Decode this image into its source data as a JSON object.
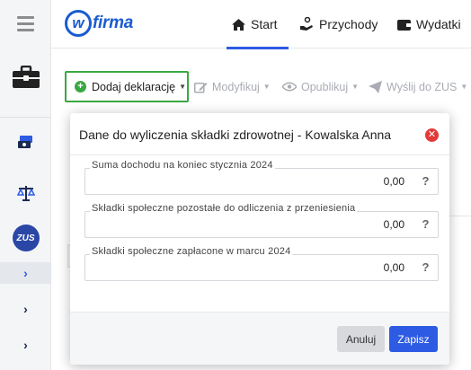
{
  "header": {
    "logo_text": "firma",
    "logo_letter": "w",
    "nav": [
      {
        "label": "Start",
        "icon": "home-icon"
      },
      {
        "label": "Przychody",
        "icon": "hand-coins-icon"
      },
      {
        "label": "Wydatki",
        "icon": "wallet-icon"
      }
    ]
  },
  "sidebar": {
    "items": [
      {
        "icon": "menu-icon"
      },
      {
        "icon": "briefcase-icon"
      },
      {
        "icon": "money-icon"
      },
      {
        "icon": "scale-icon"
      },
      {
        "icon": "zus-logo",
        "label": "ZUS"
      },
      {
        "icon": "chevron-right-icon"
      },
      {
        "icon": "chevron-right-icon"
      },
      {
        "icon": "chevron-right-icon"
      }
    ]
  },
  "toolbar": {
    "add_label": "Dodaj deklarację",
    "modify_label": "Modyfikuj",
    "publish_label": "Opublikuj",
    "send_label": "Wyślij do ZUS"
  },
  "modal": {
    "title": "Dane do wyliczenia składki zdrowotnej - Kowalska Anna",
    "fields": [
      {
        "label": "Suma dochodu na koniec stycznia 2024",
        "value": "0,00",
        "help": "?"
      },
      {
        "label": "Składki społeczne pozostałe do odliczenia z przeniesienia",
        "value": "0,00",
        "help": "?"
      },
      {
        "label": "Składki społeczne zapłacone w marcu 2024",
        "value": "0,00",
        "help": "?"
      }
    ],
    "cancel_label": "Anuluj",
    "save_label": "Zapisz"
  },
  "colors": {
    "accent": "#2d5be3",
    "brand": "#1a5bd1",
    "add_button_border": "#3aa842",
    "close": "#e23a3a"
  }
}
